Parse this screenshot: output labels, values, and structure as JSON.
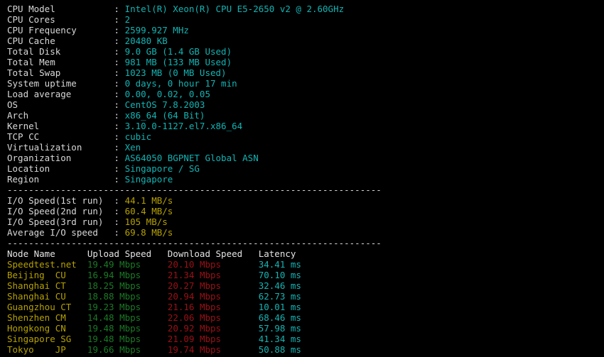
{
  "terminal": {
    "background_color": "#000000",
    "label_color": "#d8d8d8",
    "value_color": "#12b3b3",
    "io_value_color": "#b5a000",
    "node_name_color": "#b5a000",
    "upload_color": "#1a7a25",
    "download_color": "#9c1016",
    "latency_color": "#16b3b3",
    "separator": "----------------------------------------------------------------------"
  },
  "sysinfo": {
    "rows": [
      {
        "label": "CPU Model",
        "value": "Intel(R) Xeon(R) CPU E5-2650 v2 @ 2.60GHz"
      },
      {
        "label": "CPU Cores",
        "value": "2"
      },
      {
        "label": "CPU Frequency",
        "value": "2599.927 MHz"
      },
      {
        "label": "CPU Cache",
        "value": "20480 KB"
      },
      {
        "label": "Total Disk",
        "value": "9.0 GB (1.4 GB Used)"
      },
      {
        "label": "Total Mem",
        "value": "981 MB (133 MB Used)"
      },
      {
        "label": "Total Swap",
        "value": "1023 MB (0 MB Used)"
      },
      {
        "label": "System uptime",
        "value": "0 days, 0 hour 17 min"
      },
      {
        "label": "Load average",
        "value": "0.00, 0.02, 0.05"
      },
      {
        "label": "OS",
        "value": "CentOS 7.8.2003"
      },
      {
        "label": "Arch",
        "value": "x86_64 (64 Bit)"
      },
      {
        "label": "Kernel",
        "value": "3.10.0-1127.el7.x86_64"
      },
      {
        "label": "TCP CC",
        "value": "cubic"
      },
      {
        "label": "Virtualization",
        "value": "Xen"
      },
      {
        "label": "Organization",
        "value": "AS64050 BGPNET Global ASN"
      },
      {
        "label": "Location",
        "value": "Singapore / SG"
      },
      {
        "label": "Region",
        "value": "Singapore"
      }
    ]
  },
  "iospeed": {
    "rows": [
      {
        "label": "I/O Speed(1st run)",
        "value": "44.1 MB/s"
      },
      {
        "label": "I/O Speed(2nd run)",
        "value": "60.4 MB/s"
      },
      {
        "label": "I/O Speed(3rd run)",
        "value": "105 MB/s"
      },
      {
        "label": "Average I/O speed",
        "value": "69.8 MB/s"
      }
    ]
  },
  "speedtest": {
    "headers": {
      "node": "Node Name",
      "upload": "Upload Speed",
      "download": "Download Speed",
      "latency": "Latency"
    },
    "rows": [
      {
        "node": "Speedtest.net",
        "isp": "",
        "upload": "19.49 Mbps",
        "download": "20.10 Mbps",
        "latency": "34.41 ms"
      },
      {
        "node": "Beijing",
        "isp": "CU",
        "upload": "16.94 Mbps",
        "download": "21.34 Mbps",
        "latency": "70.10 ms"
      },
      {
        "node": "Shanghai",
        "isp": "CT",
        "upload": "18.25 Mbps",
        "download": "20.27 Mbps",
        "latency": "32.46 ms"
      },
      {
        "node": "Shanghai",
        "isp": "CU",
        "upload": "18.88 Mbps",
        "download": "20.94 Mbps",
        "latency": "62.73 ms"
      },
      {
        "node": "Guangzhou",
        "isp": "CT",
        "upload": "19.23 Mbps",
        "download": "21.16 Mbps",
        "latency": "10.01 ms"
      },
      {
        "node": "Shenzhen",
        "isp": "CM",
        "upload": "14.48 Mbps",
        "download": "22.06 Mbps",
        "latency": "68.46 ms"
      },
      {
        "node": "Hongkong",
        "isp": "CN",
        "upload": "19.48 Mbps",
        "download": "20.92 Mbps",
        "latency": "57.98 ms"
      },
      {
        "node": "Singapore",
        "isp": "SG",
        "upload": "19.48 Mbps",
        "download": "21.09 Mbps",
        "latency": "41.34 ms"
      },
      {
        "node": "Tokyo",
        "isp": "JP",
        "upload": "19.66 Mbps",
        "download": "19.74 Mbps",
        "latency": "50.88 ms"
      }
    ]
  }
}
